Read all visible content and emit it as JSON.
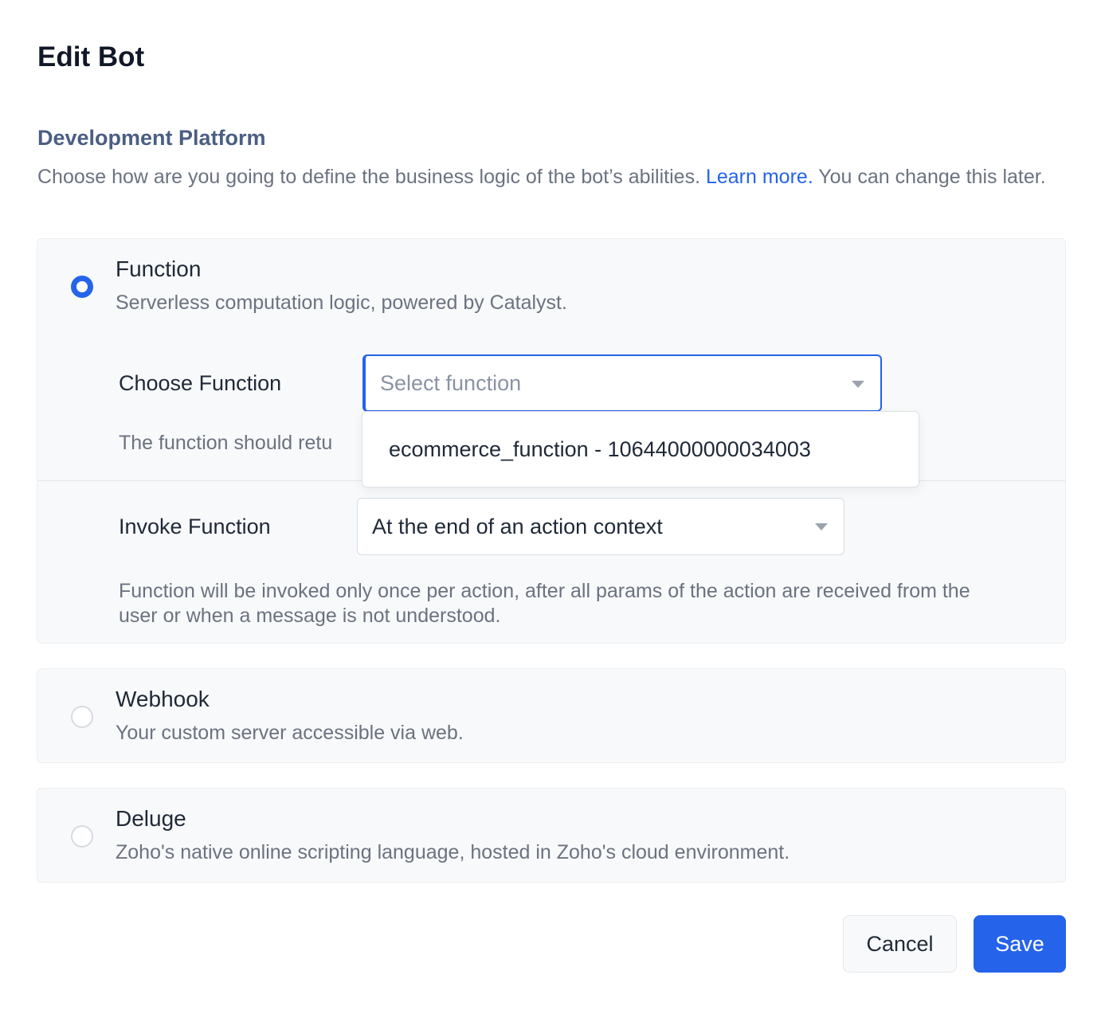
{
  "dialog": {
    "title": "Edit Bot"
  },
  "platform": {
    "heading": "Development Platform",
    "desc_before": "Choose how are you going to define the business logic of the bot’s abilities. ",
    "learn_more": "Learn more.",
    "desc_after": " You can change this later."
  },
  "options": [
    {
      "title": "Function",
      "desc": "Serverless computation logic, powered by Catalyst.",
      "selected": true
    },
    {
      "title": "Webhook",
      "desc": "Your custom server accessible via web.",
      "selected": false
    },
    {
      "title": "Deluge",
      "desc": "Zoho's native online scripting language, hosted in Zoho's cloud environment.",
      "selected": false
    }
  ],
  "function_config": {
    "choose_label": "Choose Function",
    "choose_placeholder": "Select function",
    "choose_help": "The function should retu",
    "dropdown_items": [
      "ecommerce_function - 10644000000034003"
    ],
    "invoke_label": "Invoke Function",
    "invoke_value": "At the end of an action context",
    "invoke_help": "Function will be invoked only once per action, after all params of the action are received from the user or when a message is not understood."
  },
  "footer": {
    "cancel_label": "Cancel",
    "save_label": "Save"
  },
  "colors": {
    "accent": "#2563eb",
    "heading": "#4b5e82",
    "card_bg": "#f8f9fa"
  }
}
